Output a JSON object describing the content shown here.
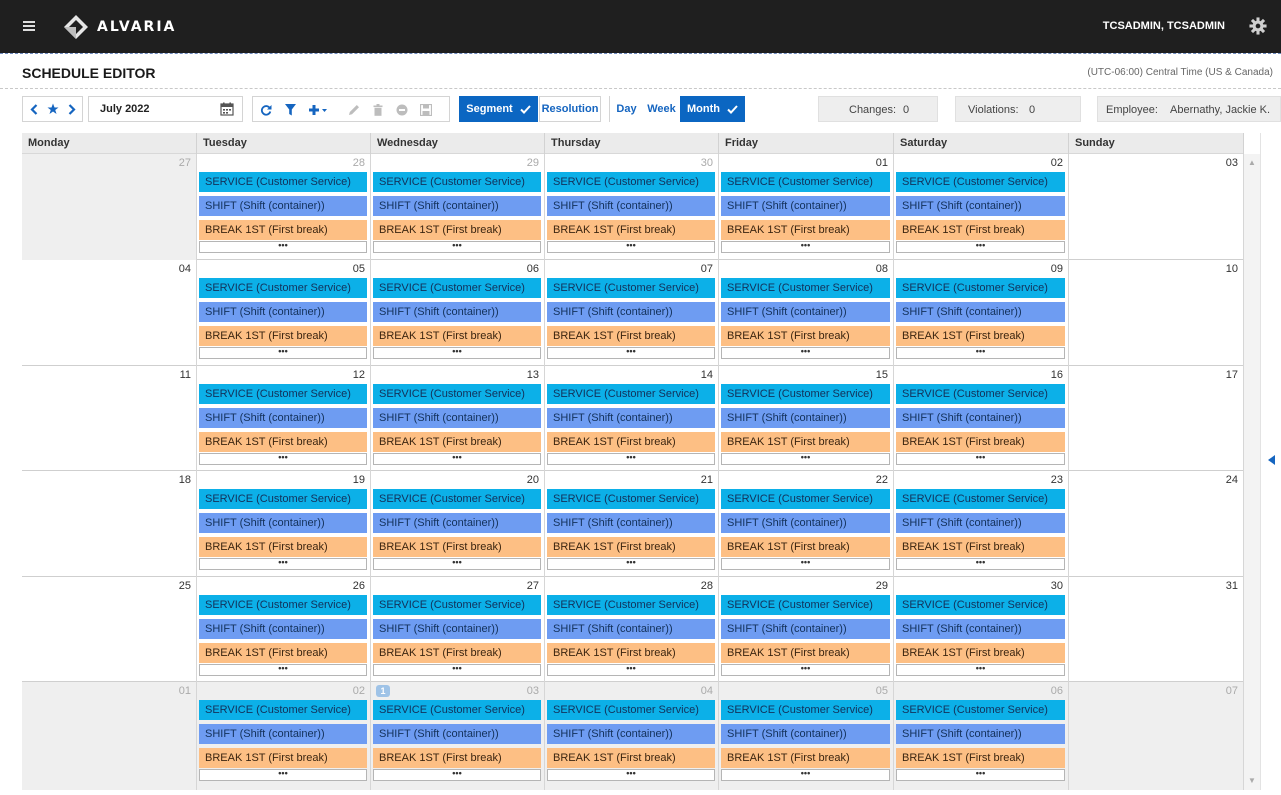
{
  "app": {
    "brand": "ALVARIA",
    "user": "TCSADMIN, TCSADMIN"
  },
  "page": {
    "title": "SCHEDULE EDITOR",
    "timezone": "(UTC-06:00) Central Time (US & Canada)"
  },
  "toolbar": {
    "date": "July 2022",
    "segment_label": "Segment",
    "resolution_label": "Resolution",
    "day_label": "Day",
    "week_label": "Week",
    "month_label": "Month",
    "changes_label": "Changes:",
    "changes_value": "0",
    "violations_label": "Violations:",
    "violations_value": "0",
    "employee_label": "Employee:",
    "employee_value": "Abernathy, Jackie K."
  },
  "calendar": {
    "weekdays": [
      "Monday",
      "Tuesday",
      "Wednesday",
      "Thursday",
      "Friday",
      "Saturday",
      "Sunday"
    ],
    "event_labels": {
      "service": "SERVICE (Customer Service)",
      "shift": "SHIFT (Shift (container))",
      "break": "BREAK 1ST (First break)",
      "more": "•••"
    },
    "weeks": [
      {
        "days": [
          {
            "num": "27",
            "muted": true,
            "grey": true,
            "events": false
          },
          {
            "num": "28",
            "muted": true,
            "events": true
          },
          {
            "num": "29",
            "muted": true,
            "events": true
          },
          {
            "num": "30",
            "muted": true,
            "events": true
          },
          {
            "num": "01",
            "events": true
          },
          {
            "num": "02",
            "events": true
          },
          {
            "num": "03",
            "events": false
          }
        ]
      },
      {
        "days": [
          {
            "num": "04",
            "events": false
          },
          {
            "num": "05",
            "events": true
          },
          {
            "num": "06",
            "events": true
          },
          {
            "num": "07",
            "events": true
          },
          {
            "num": "08",
            "events": true
          },
          {
            "num": "09",
            "events": true
          },
          {
            "num": "10",
            "events": false
          }
        ]
      },
      {
        "days": [
          {
            "num": "11",
            "events": false
          },
          {
            "num": "12",
            "events": true
          },
          {
            "num": "13",
            "events": true
          },
          {
            "num": "14",
            "events": true
          },
          {
            "num": "15",
            "events": true
          },
          {
            "num": "16",
            "events": true
          },
          {
            "num": "17",
            "events": false
          }
        ]
      },
      {
        "days": [
          {
            "num": "18",
            "events": false
          },
          {
            "num": "19",
            "events": true
          },
          {
            "num": "20",
            "events": true
          },
          {
            "num": "21",
            "events": true
          },
          {
            "num": "22",
            "events": true
          },
          {
            "num": "23",
            "events": true
          },
          {
            "num": "24",
            "events": false
          }
        ]
      },
      {
        "days": [
          {
            "num": "25",
            "events": false
          },
          {
            "num": "26",
            "events": true
          },
          {
            "num": "27",
            "events": true
          },
          {
            "num": "28",
            "events": true
          },
          {
            "num": "29",
            "events": true
          },
          {
            "num": "30",
            "events": true
          },
          {
            "num": "31",
            "events": false
          }
        ]
      },
      {
        "days": [
          {
            "num": "01",
            "muted": true,
            "grey": true,
            "events": false
          },
          {
            "num": "02",
            "muted": true,
            "grey": true,
            "events": true
          },
          {
            "num": "03",
            "muted": true,
            "grey": true,
            "events": true,
            "badge": "1"
          },
          {
            "num": "04",
            "muted": true,
            "grey": true,
            "events": true
          },
          {
            "num": "05",
            "muted": true,
            "grey": true,
            "events": true
          },
          {
            "num": "06",
            "muted": true,
            "grey": true,
            "events": true
          },
          {
            "num": "07",
            "muted": true,
            "grey": true,
            "events": false
          }
        ]
      }
    ]
  },
  "colors": {
    "topbar": "#1f1f1f",
    "accent": "#0b66c2",
    "service": "#0cb0e8",
    "shift": "#6e9cf2",
    "break": "#fdbf84"
  },
  "icons": [
    "menu-icon",
    "alvaria-logo",
    "gear-icon",
    "chevron-left-icon",
    "star-icon",
    "chevron-right-icon",
    "calendar-icon",
    "refresh-icon",
    "filter-icon",
    "add-icon",
    "edit-icon",
    "delete-icon",
    "cancel-icon",
    "save-icon",
    "check-icon"
  ]
}
